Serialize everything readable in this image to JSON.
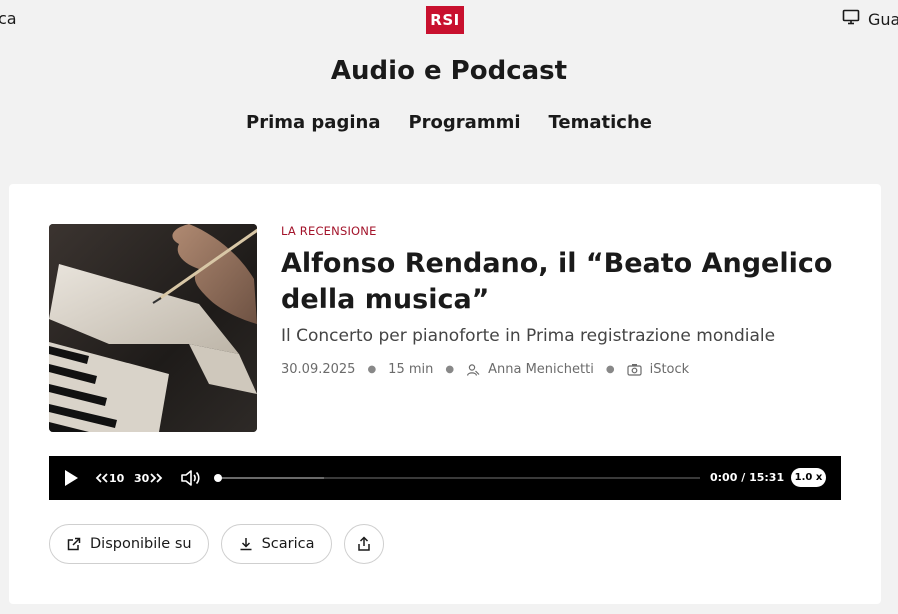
{
  "header": {
    "left_partial": "ca",
    "logo_text": "RSI",
    "right_partial": "Gua",
    "right_icon": "monitor-icon",
    "site_title": "Audio e Podcast"
  },
  "nav": {
    "items": [
      "Prima pagina",
      "Programmi",
      "Tematiche"
    ]
  },
  "article": {
    "kicker": "LA RECENSIONE",
    "title": "Alfonso Rendano, il “Beato Angelico della musica”",
    "subtitle": "Il Concerto per pianoforte in Prima registrazione mondiale",
    "date": "30.09.2025",
    "duration": "15 min",
    "author": "Anna Menichetti",
    "photo_credit": "iStock"
  },
  "player": {
    "rewind_label": "10",
    "forward_label": "30",
    "current_time": "0:00",
    "separator": "/",
    "total_time": "15:31",
    "speed": "1.0 x",
    "progress": 0.0,
    "buffered": 0.22
  },
  "actions": {
    "available_label": "Disponibile su",
    "download_label": "Scarica"
  },
  "colors": {
    "brand": "#c8102e",
    "kicker": "#a3132a",
    "player_bg": "#000000"
  }
}
